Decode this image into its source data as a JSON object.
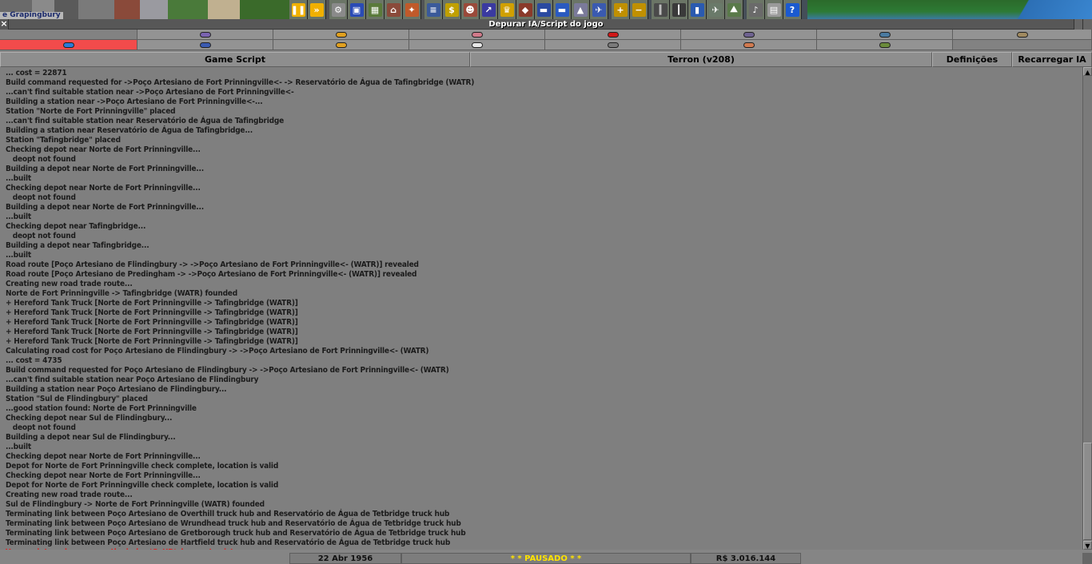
{
  "town_label": "e Grapingbury",
  "toolbar_icons": [
    {
      "name": "pause-icon",
      "glyph": "❚❚",
      "color": "#f0b000"
    },
    {
      "name": "fast-forward-icon",
      "glyph": "»",
      "color": "#f0b000"
    },
    {
      "name": "settings-icon",
      "glyph": "⚙",
      "color": "#8a8a8a"
    },
    {
      "name": "save-icon",
      "glyph": "▣",
      "color": "#2a4bb5"
    },
    {
      "name": "map-icon",
      "glyph": "▦",
      "color": "#5a7a3a"
    },
    {
      "name": "town-directory-icon",
      "glyph": "⌂",
      "color": "#8a4a3a"
    },
    {
      "name": "subsidies-icon",
      "glyph": "✦",
      "color": "#c05a2a"
    },
    {
      "name": "stations-list-icon",
      "glyph": "≡",
      "color": "#3a5a9a"
    },
    {
      "name": "finances-icon",
      "glyph": "$",
      "color": "#c0a000"
    },
    {
      "name": "company-icon",
      "glyph": "☻",
      "color": "#9a4a3a"
    },
    {
      "name": "graphs-icon",
      "glyph": "↗",
      "color": "#3a3aa0"
    },
    {
      "name": "league-table-icon",
      "glyph": "♛",
      "color": "#d0a000"
    },
    {
      "name": "industries-icon",
      "glyph": "◆",
      "color": "#8a3a2a"
    },
    {
      "name": "trains-icon",
      "glyph": "▬",
      "color": "#2a4aa0"
    },
    {
      "name": "road-vehicles-icon",
      "glyph": "▬",
      "color": "#2a5ac0"
    },
    {
      "name": "ships-icon",
      "glyph": "▲",
      "color": "#7a7a9a"
    },
    {
      "name": "aircraft-icon",
      "glyph": "✈",
      "color": "#3a5ab0"
    },
    {
      "name": "zoom-in-icon",
      "glyph": "+",
      "color": "#c09000"
    },
    {
      "name": "zoom-out-icon",
      "glyph": "−",
      "color": "#c09000"
    },
    {
      "name": "build-railway-icon",
      "glyph": "║",
      "color": "#4a4a4a"
    },
    {
      "name": "build-road-icon",
      "glyph": "┃",
      "color": "#3a3a3a"
    },
    {
      "name": "build-docks-icon",
      "glyph": "▮",
      "color": "#2a5ab0"
    },
    {
      "name": "build-airport-icon",
      "glyph": "✈",
      "color": "#6a7a6a"
    },
    {
      "name": "landscaping-icon",
      "glyph": "⛰",
      "color": "#5a7a4a"
    },
    {
      "name": "sound-icon",
      "glyph": "♪",
      "color": "#6a6a6a"
    },
    {
      "name": "news-messages-icon",
      "glyph": "▤",
      "color": "#9a9a9a"
    },
    {
      "name": "help-icon",
      "glyph": "?",
      "color": "#1a5ad0"
    }
  ],
  "window": {
    "title": "Depurar IA/Script do jogo"
  },
  "companies": {
    "row1": [
      {
        "pill": null,
        "active": false
      },
      {
        "pill": "#7a63b0"
      },
      {
        "pill": "#e0a020"
      },
      {
        "pill": "#d07a8a"
      },
      {
        "pill": "#d01818"
      },
      {
        "pill": "#6e6290"
      },
      {
        "pill": "#4a7aa0"
      },
      {
        "pill": "#a08a60"
      }
    ],
    "row2": [
      {
        "pill": "#2a7ad8",
        "active": true
      },
      {
        "pill": "#3a5ab0"
      },
      {
        "pill": "#e0a020"
      },
      {
        "pill": "#e8e8e8"
      },
      {
        "pill": "#7a7a7a"
      },
      {
        "pill": "#d07a50"
      },
      {
        "pill": "#6a8a3a"
      },
      {
        "pill": null
      }
    ]
  },
  "header": {
    "game_script": "Game Script",
    "ai_name": "Terron (v208)",
    "settings": "Definições",
    "reload": "Recarregar IA"
  },
  "log_lines": [
    "... cost = 22871",
    "Build command requested for ->Poço Artesiano de Fort Prinningville<- -> Reservatório de Água de Tafingbridge (WATR)",
    "...can't find suitable station near ->Poço Artesiano de Fort Prinningville<-",
    "Building a station near ->Poço Artesiano de Fort Prinningville<-...",
    "Station \"Norte de Fort Prinningville\" placed",
    "...can't find suitable station near Reservatório de Água de Tafingbridge",
    "Building a station near Reservatório de Água de Tafingbridge...",
    "Station \"Tafingbridge\" placed",
    "Checking depot near Norte de Fort Prinningville...",
    "   deopt not found",
    "Building a depot near Norte de Fort Prinningville...",
    "...built",
    "Checking depot near Norte de Fort Prinningville...",
    "   deopt not found",
    "Building a depot near Norte de Fort Prinningville...",
    "...built",
    "Checking depot near Tafingbridge...",
    "   deopt not found",
    "Building a depot near Tafingbridge...",
    "...built",
    "Road route [Poço Artesiano de Flindingbury -> ->Poço Artesiano de Fort Prinningville<- (WATR)] revealed",
    "Road route [Poço Artesiano de Predingham -> ->Poço Artesiano de Fort Prinningville<- (WATR)] revealed",
    "Creating new road trade route...",
    "Norte de Fort Prinningville -> Tafingbridge (WATR) founded",
    "+ Hereford Tank Truck [Norte de Fort Prinningville -> Tafingbridge (WATR)]",
    "+ Hereford Tank Truck [Norte de Fort Prinningville -> Tafingbridge (WATR)]",
    "+ Hereford Tank Truck [Norte de Fort Prinningville -> Tafingbridge (WATR)]",
    "+ Hereford Tank Truck [Norte de Fort Prinningville -> Tafingbridge (WATR)]",
    "+ Hereford Tank Truck [Norte de Fort Prinningville -> Tafingbridge (WATR)]",
    "Calculating road cost for Poço Artesiano de Flindingbury -> ->Poço Artesiano de Fort Prinningville<- (WATR)",
    "... cost = 4735",
    "Build command requested for Poço Artesiano de Flindingbury -> ->Poço Artesiano de Fort Prinningville<- (WATR)",
    "...can't find suitable station near Poço Artesiano de Flindingbury",
    "Building a station near Poço Artesiano de Flindingbury...",
    "Station \"Sul de Flindingbury\" placed",
    "...good station found: Norte de Fort Prinningville",
    "Checking depot near Sul de Flindingbury...",
    "   deopt not found",
    "Building a depot near Sul de Flindingbury...",
    "...built",
    "Checking depot near Norte de Fort Prinningville...",
    "Depot for Norte de Fort Prinningville check complete, location is valid",
    "Checking depot near Norte de Fort Prinningville...",
    "Depot for Norte de Fort Prinningville check complete, location is valid",
    "Creating new road trade route...",
    "Sul de Flindingbury -> Norte de Fort Prinningville (WATR) founded",
    "Terminating link between Poço Artesiano de Overthill truck hub and Reservatório de Água de Tetbridge truck hub",
    "Terminating link between Poço Artesiano de Wrundhead truck hub and Reservatório de Água de Tetbridge truck hub",
    "Terminating link between Poço Artesiano de Gretborough truck hub and Reservatório de Água de Tetbridge truck hub",
    "Terminating link between Poço Artesiano de Hartfield truck hub and Reservatório de Água de Tetbridge truck hub"
  ],
  "error_line": "Your script made an error: the index 'GetID' does not exist",
  "status": {
    "date": "22 Abr 1956",
    "paused": "* *  PAUSADO  * *",
    "money": "R$ 3.016.144"
  }
}
